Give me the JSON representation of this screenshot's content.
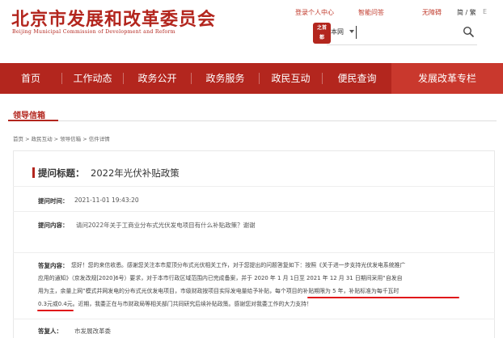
{
  "site": {
    "title": "北京市发展和改革委员会",
    "subtitle": "Beijing Municipal Commission of Development and Reform"
  },
  "toplinks": [
    {
      "label": "登录个人中心"
    },
    {
      "label": "智能问答"
    },
    {
      "label": "无障碍"
    },
    {
      "label": "简 / 繁"
    },
    {
      "label": "E"
    }
  ],
  "seal": {
    "line1": "之首",
    "line2": "都"
  },
  "search": {
    "scope": "本网",
    "placeholder": ""
  },
  "nav": [
    {
      "label": "首页"
    },
    {
      "label": "工作动态"
    },
    {
      "label": "政务公开"
    },
    {
      "label": "政务服务"
    },
    {
      "label": "政民互动"
    },
    {
      "label": "便民查询"
    },
    {
      "label": "发展改革专栏"
    }
  ],
  "section": {
    "title": "领导信箱"
  },
  "breadcrumb": "首页 > 政民互动 > 领导信箱 > 信件详情",
  "letter": {
    "question_label": "提问标题：",
    "question_title": "2022年光伏补贴政策",
    "time_label": "提问时间：",
    "time_value": "2021-11-01 19:43:20",
    "content_label": "提问内容：",
    "content_value": "请问2022年关于工商业分布式光伏发电项目有什么补贴政策？谢谢",
    "answer_label": "答复内容：",
    "answer_lines": [
      "您好！您的来信收悉。感谢您关注本市屋顶分布式光伏相关工作，对于您提出的问题答复如下：按照《关于进一步支持光伏发电系统推广",
      "应用的通知》（京发改规[2020]6号）要求，对于本市行政区域范围内已完成备案，并于 2020 年 1 月 1日至 2021 年 12 月 31 日期间采用“自发自",
      "用为主，余量上网”模式并网发电的分布式光伏发电项目，市级财政按项目实际发电量给予补贴，每个项目的补贴期限为 5 年，补贴标准为每千瓦时",
      "0.3元或0.4元。近期，我委正在与市财政局等相关部门共同研究后续补贴政策。感谢您对我委工作的大力支持！"
    ],
    "replier_label": "答复人：",
    "replier_value": "市发展改革委"
  },
  "colors": {
    "brand_red": "#b3261e",
    "underline_red": "#e0181a"
  }
}
